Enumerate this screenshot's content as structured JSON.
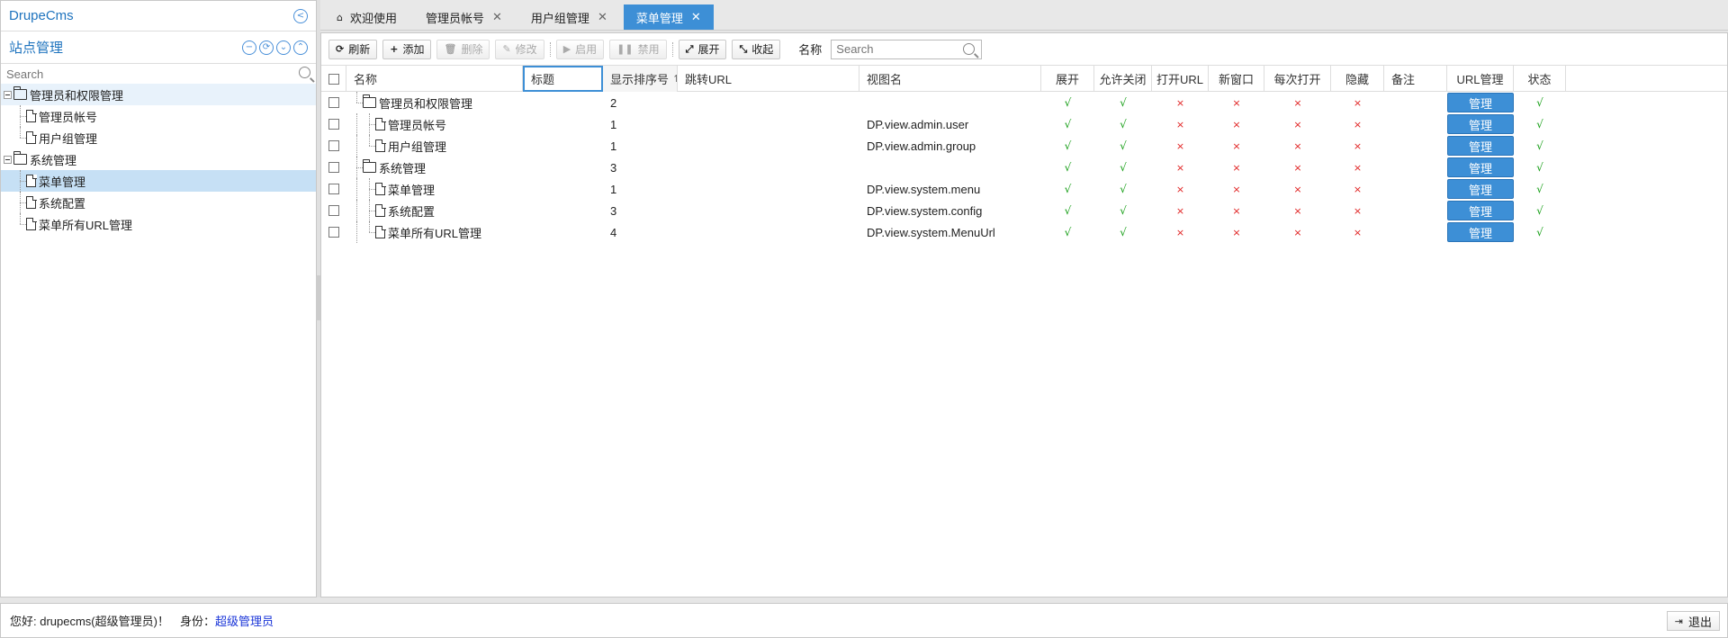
{
  "app": {
    "title": "DrupeCms"
  },
  "sidebar": {
    "section_title": "站点管理",
    "search_placeholder": "Search",
    "icons": [
      "collapse-left-icon",
      "minus-circle-icon",
      "refresh-icon",
      "expand-all-icon",
      "collapse-all-icon"
    ],
    "tree": [
      {
        "label": "管理员和权限管理",
        "type": "folder",
        "level": 0,
        "state": "hover"
      },
      {
        "label": "管理员帐号",
        "type": "file",
        "level": 1
      },
      {
        "label": "用户组管理",
        "type": "file",
        "level": 1
      },
      {
        "label": "系统管理",
        "type": "folder",
        "level": 0
      },
      {
        "label": "菜单管理",
        "type": "file",
        "level": 1,
        "state": "selected"
      },
      {
        "label": "系统配置",
        "type": "file",
        "level": 1
      },
      {
        "label": "菜单所有URL管理",
        "type": "file",
        "level": 1
      }
    ]
  },
  "tabs": [
    {
      "label": "欢迎使用",
      "icon": "home-icon",
      "closable": false,
      "active": false
    },
    {
      "label": "管理员帐号",
      "closable": true,
      "active": false
    },
    {
      "label": "用户组管理",
      "closable": true,
      "active": false
    },
    {
      "label": "菜单管理",
      "closable": true,
      "active": true
    }
  ],
  "toolbar": {
    "buttons": [
      {
        "label": "刷新",
        "icon": "refresh-icon",
        "glyph": "⟳",
        "disabled": false
      },
      {
        "label": "添加",
        "icon": "plus-icon",
        "glyph": "+",
        "disabled": false
      },
      {
        "label": "删除",
        "icon": "trash-icon",
        "glyph": "🗑",
        "disabled": true
      },
      {
        "label": "修改",
        "icon": "pencil-icon",
        "glyph": "✎",
        "disabled": true
      },
      {
        "label": "启用",
        "icon": "play-icon",
        "glyph": "▶",
        "disabled": true
      },
      {
        "label": "禁用",
        "icon": "pause-icon",
        "glyph": "❚❚",
        "disabled": true
      },
      {
        "label": "展开",
        "icon": "expand-icon",
        "glyph": "⤢",
        "disabled": false
      },
      {
        "label": "收起",
        "icon": "compress-icon",
        "glyph": "⤡",
        "disabled": false
      }
    ],
    "name_label": "名称",
    "search_placeholder": "Search"
  },
  "grid": {
    "columns": [
      "名称",
      "标题",
      "显示排序号",
      "跳转URL",
      "视图名",
      "展开",
      "允许关闭",
      "打开URL",
      "新窗口",
      "每次打开",
      "隐藏",
      "备注",
      "URL管理",
      "状态"
    ],
    "sort_arrow": "↑",
    "yes_glyph": "√",
    "no_glyph": "×",
    "manage_label": "管理",
    "rows": [
      {
        "name": "管理员和权限管理",
        "type": "folder",
        "level": 0,
        "order": "2",
        "view": "",
        "expand": true,
        "allow_close": true,
        "open_url": false,
        "new_window": false,
        "each_open": false,
        "hidden": false,
        "status": true
      },
      {
        "name": "管理员帐号",
        "type": "file",
        "level": 1,
        "order": "1",
        "view": "DP.view.admin.user",
        "expand": true,
        "allow_close": true,
        "open_url": false,
        "new_window": false,
        "each_open": false,
        "hidden": false,
        "status": true
      },
      {
        "name": "用户组管理",
        "type": "file",
        "level": 1,
        "order": "1",
        "view": "DP.view.admin.group",
        "expand": true,
        "allow_close": true,
        "open_url": false,
        "new_window": false,
        "each_open": false,
        "hidden": false,
        "status": true
      },
      {
        "name": "系统管理",
        "type": "folder",
        "level": 0,
        "order": "3",
        "view": "",
        "expand": true,
        "allow_close": true,
        "open_url": false,
        "new_window": false,
        "each_open": false,
        "hidden": false,
        "status": true
      },
      {
        "name": "菜单管理",
        "type": "file",
        "level": 1,
        "order": "1",
        "view": "DP.view.system.menu",
        "expand": true,
        "allow_close": true,
        "open_url": false,
        "new_window": false,
        "each_open": false,
        "hidden": false,
        "status": true
      },
      {
        "name": "系统配置",
        "type": "file",
        "level": 1,
        "order": "3",
        "view": "DP.view.system.config",
        "expand": true,
        "allow_close": true,
        "open_url": false,
        "new_window": false,
        "each_open": false,
        "hidden": false,
        "status": true
      },
      {
        "name": "菜单所有URL管理",
        "type": "file",
        "level": 1,
        "order": "4",
        "view": "DP.view.system.MenuUrl",
        "expand": true,
        "allow_close": true,
        "open_url": false,
        "new_window": false,
        "each_open": false,
        "hidden": false,
        "status": true
      }
    ]
  },
  "footer": {
    "greeting": "您好: drupecms(超级管理员)！",
    "identity_label": "身份：",
    "identity_value": "超级管理员",
    "logout_label": "退出"
  },
  "colors": {
    "accent": "#3d8fd6",
    "title_blue": "#1e73be",
    "yes": "#1aa01a",
    "no": "#e02020",
    "selected_row": "#c6e0f5"
  }
}
